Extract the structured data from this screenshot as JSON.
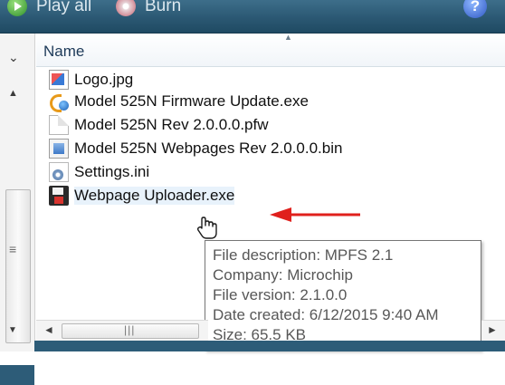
{
  "toolbar": {
    "play_all_label": "Play all",
    "burn_label": "Burn",
    "help_glyph": "?"
  },
  "navigation": {
    "expand_glyph": "⌄",
    "scroll_up_glyph": "▲",
    "grip_glyph": "≡",
    "scroll_down_glyph": "▼"
  },
  "columns": {
    "name_label": "Name",
    "sort_glyph": "▲"
  },
  "files": [
    {
      "name": "Logo.jpg",
      "icon": "jpg-file-icon"
    },
    {
      "name": "Model 525N Firmware Update.exe",
      "icon": "exe-file-icon"
    },
    {
      "name": "Model 525N Rev 2.0.0.0.pfw",
      "icon": "blank-file-icon"
    },
    {
      "name": "Model 525N Webpages Rev 2.0.0.0.bin",
      "icon": "bin-file-icon"
    },
    {
      "name": "Settings.ini",
      "icon": "ini-file-icon"
    },
    {
      "name": "Webpage Uploader.exe",
      "icon": "floppy-exe-icon"
    }
  ],
  "tooltip": {
    "description": "File description: MPFS 2.1",
    "company": "Company: Microchip",
    "version": "File version: 2.1.0.0",
    "created": "Date created: 6/12/2015 9:40 AM",
    "size": "Size: 65.5 KB"
  },
  "hscroll": {
    "left_glyph": "◄",
    "right_glyph": "►",
    "grip_glyph": "|||"
  },
  "colors": {
    "toolbar": "#2b5873",
    "annotation_arrow": "#e0201c",
    "tooltip_text": "#575757"
  }
}
